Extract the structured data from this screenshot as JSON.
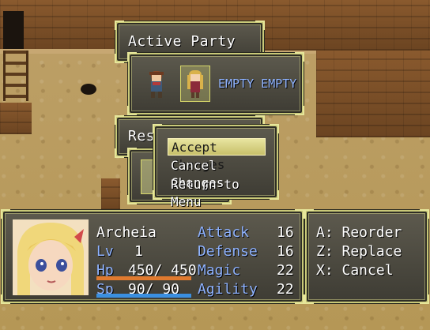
{
  "active_party": {
    "title": "Active Party",
    "slots": [
      "hero-1",
      "hero-2"
    ],
    "empty_label": "EMPTY EMPTY"
  },
  "reserve_party": {
    "title": "Reserve Party"
  },
  "confirm_menu": {
    "items": [
      "Accept Changes",
      "Cancel Changes",
      "Return to Menu"
    ],
    "selected_index": 0
  },
  "status": {
    "name": "Archeia",
    "level_label": "Lv",
    "level": "1",
    "hp_label": "Hp",
    "hp_value": "450/ 450",
    "hp_fraction": 1.0,
    "sp_label": "Sp",
    "sp_value": " 90/  90",
    "sp_fraction": 1.0,
    "stats": [
      {
        "label": "Attack",
        "value": "16"
      },
      {
        "label": "Defense",
        "value": "16"
      },
      {
        "label": "Magic",
        "value": "22"
      },
      {
        "label": "Agility",
        "value": "22"
      }
    ]
  },
  "help": {
    "lines": [
      "A: Reorder",
      "Z: Replace",
      "X: Cancel"
    ]
  },
  "colors": {
    "hp_bar": "#e07a2f",
    "sp_bar": "#3a8fe0",
    "system_text": "#8fb3ff",
    "highlight": "#e8e4a0"
  }
}
